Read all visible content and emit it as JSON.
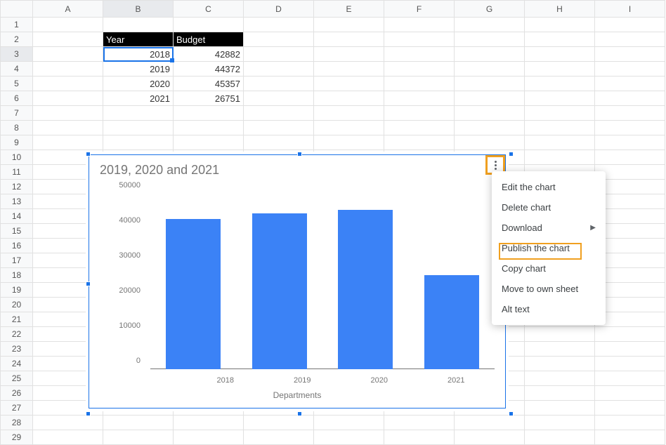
{
  "columns": [
    "A",
    "B",
    "C",
    "D",
    "E",
    "F",
    "G",
    "H",
    "I"
  ],
  "row_count": 29,
  "active_col_index": 1,
  "active_row_index": 2,
  "selected_cell": {
    "col": 1,
    "row": 2
  },
  "header_row": 1,
  "header_cells": {
    "year_label": "Year",
    "budget_label": "Budget"
  },
  "table": {
    "rows": [
      {
        "year": "2018",
        "budget": "42882"
      },
      {
        "year": "2019",
        "budget": "44372"
      },
      {
        "year": "2020",
        "budget": "45357"
      },
      {
        "year": "2021",
        "budget": "26751"
      }
    ]
  },
  "chart_data": {
    "type": "bar",
    "title": "2019, 2020 and 2021",
    "xlabel": "Departments",
    "ylabel": "",
    "categories": [
      "2018",
      "2019",
      "2020",
      "2021"
    ],
    "values": [
      42882,
      44372,
      45357,
      26751
    ],
    "ylim": [
      0,
      50000
    ],
    "yticks": [
      0,
      10000,
      20000,
      30000,
      40000,
      50000
    ],
    "bar_color": "#3b82f6"
  },
  "menu": {
    "items": [
      {
        "label": "Edit the chart",
        "submenu": false
      },
      {
        "label": "Delete chart",
        "submenu": false
      },
      {
        "label": "Download",
        "submenu": true
      },
      {
        "label": "Publish the chart",
        "submenu": false
      },
      {
        "label": "Copy chart",
        "submenu": false
      },
      {
        "label": "Move to own sheet",
        "submenu": false
      },
      {
        "label": "Alt text",
        "submenu": false
      }
    ]
  }
}
